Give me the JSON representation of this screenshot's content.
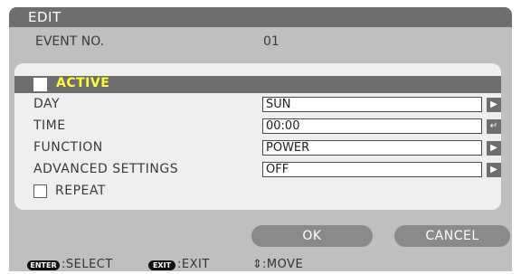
{
  "dialog": {
    "title": "EDIT"
  },
  "event": {
    "label": "EVENT NO.",
    "value": "01"
  },
  "active": {
    "label": "ACTIVE",
    "checked": false
  },
  "settings": [
    {
      "label": "DAY",
      "value": "SUN",
      "button_icon": "right-arrow-icon"
    },
    {
      "label": "TIME",
      "value": "00:00",
      "button_icon": "enter-icon"
    },
    {
      "label": "FUNCTION",
      "value": "POWER",
      "button_icon": "right-arrow-icon"
    },
    {
      "label": "ADVANCED SETTINGS",
      "value": "OFF",
      "button_icon": "right-arrow-icon"
    }
  ],
  "repeat": {
    "label": "REPEAT",
    "checked": false
  },
  "buttons": {
    "ok": "OK",
    "cancel": "CANCEL"
  },
  "hints": [
    {
      "key": "ENTER",
      "text": ":SELECT"
    },
    {
      "key": "EXIT",
      "text": ":EXIT"
    },
    {
      "key": "⇕",
      "text": ":MOVE"
    }
  ],
  "colors": {
    "dialog_bg": "#bfbfbf",
    "panel_bg": "#efefef",
    "bar_dark": "#6e6e6e",
    "active_text": "#ffff33",
    "button_pill": "#8a8a8a"
  }
}
